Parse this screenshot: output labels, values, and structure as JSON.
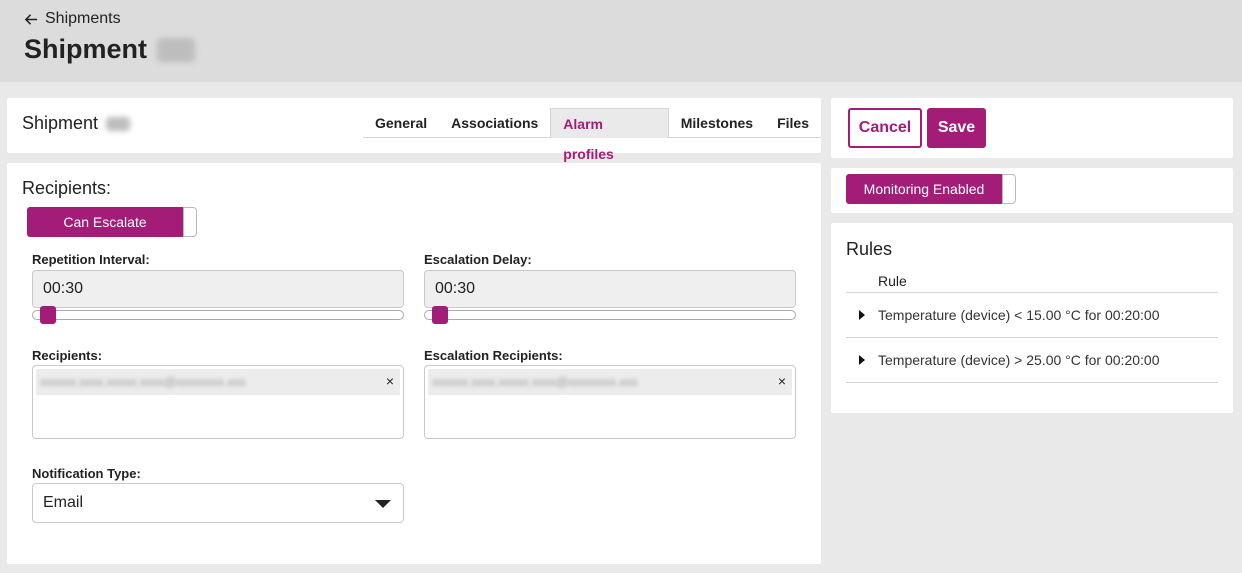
{
  "topbar": {
    "back_label": "Shipments",
    "title": "Shipment"
  },
  "header": {
    "subtitle": "Shipment",
    "tabs": [
      {
        "label": "General"
      },
      {
        "label": "Associations"
      },
      {
        "label": "Alarm profiles",
        "active": true
      },
      {
        "label": "Milestones"
      },
      {
        "label": "Files"
      }
    ]
  },
  "form": {
    "recipients_title": "Recipients:",
    "can_escalate_label": "Can Escalate",
    "repetition_interval": {
      "label": "Repetition Interval:",
      "value": "00:30"
    },
    "escalation_delay": {
      "label": "Escalation Delay:",
      "value": "00:30"
    },
    "recipients": {
      "label": "Recipients:",
      "close": "×"
    },
    "escalation_recipients": {
      "label": "Escalation Recipients:",
      "close": "×"
    },
    "notification_type": {
      "label": "Notification Type:",
      "value": "Email"
    }
  },
  "actions": {
    "cancel_label": "Cancel",
    "save_label": "Save"
  },
  "monitoring": {
    "label": "Monitoring Enabled"
  },
  "rules": {
    "title": "Rules",
    "column_header": "Rule",
    "rows": [
      {
        "text": "Temperature (device) < 15.00 °C for 00:20:00"
      },
      {
        "text": "Temperature (device) > 25.00 °C for 00:20:00"
      }
    ]
  },
  "colors": {
    "accent": "#a21c78",
    "background": "#e9e9e9",
    "topbar": "#dcdcdc"
  }
}
